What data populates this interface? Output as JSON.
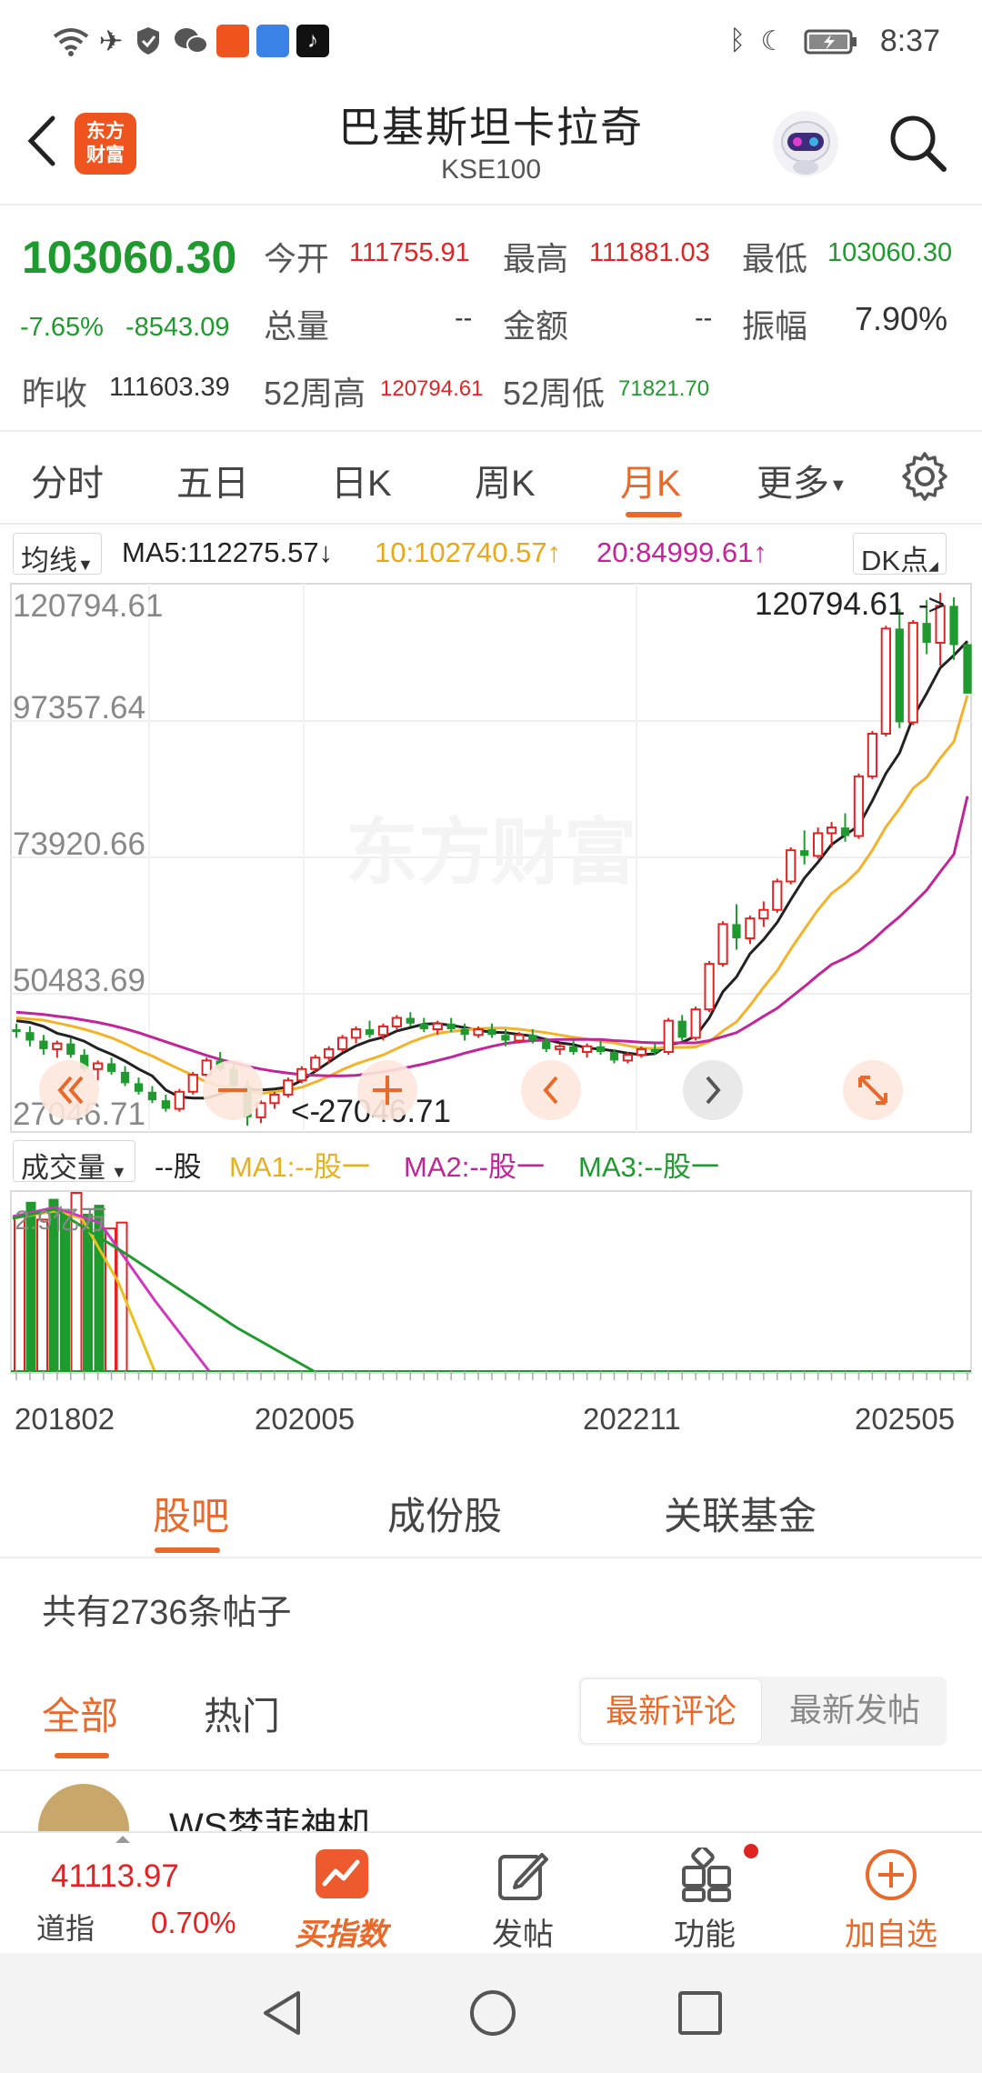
{
  "status_bar": {
    "time": "8:37",
    "icons": [
      "wifi-icon",
      "airplane-icon",
      "shield-icon",
      "wechat-icon",
      "app-icon-1",
      "weather-icon",
      "tiktok-icon",
      "bluetooth-icon",
      "moon-icon",
      "battery-icon"
    ]
  },
  "header": {
    "logo_line1": "东方",
    "logo_line2": "财富",
    "title": "巴基斯坦卡拉奇",
    "subtitle": "KSE100"
  },
  "quote": {
    "price": "103060.30",
    "change_pct": "-7.65%",
    "change_abs": "-8543.09",
    "open_label": "今开",
    "open": "111755.91",
    "high_label": "最高",
    "high": "111881.03",
    "low_label": "最低",
    "low": "103060.30",
    "volume_label": "总量",
    "volume": "--",
    "amount_label": "金额",
    "amount": "--",
    "amplitude_label": "振幅",
    "amplitude": "7.90%",
    "prev_close_label": "昨收",
    "prev_close": "111603.39",
    "wk52_high_label": "52周高",
    "wk52_high": "120794.61",
    "wk52_low_label": "52周低",
    "wk52_low": "71821.70"
  },
  "tabs": [
    "分时",
    "五日",
    "日K",
    "周K",
    "月K",
    "更多"
  ],
  "active_tab": "月K",
  "ma_legend": {
    "selector": "均线",
    "ma5": "MA5:112275.57",
    "ma5_arrow": "↓",
    "ma10": "10:102740.57",
    "ma10_arrow": "↑",
    "ma20": "20:84999.61",
    "ma20_arrow": "↑",
    "dk_button": "DK点"
  },
  "chart_data": {
    "type": "candlestick",
    "y_labels": [
      "120794.61",
      "97357.64",
      "73920.66",
      "50483.69",
      "27046.71"
    ],
    "ylim": [
      27046.71,
      120794.61
    ],
    "max_marker": "120794.61",
    "min_marker": "27046.71",
    "watermark": "东方财富",
    "colors": {
      "up": "#e02424",
      "down": "#1f9a2e",
      "ma5": "#222222",
      "ma10": "#f2b32a",
      "ma20": "#c2249a"
    },
    "candles": [
      [
        44000,
        45000,
        42500,
        43500
      ],
      [
        43500,
        44500,
        41000,
        42000
      ],
      [
        42000,
        43000,
        39500,
        40500
      ],
      [
        40500,
        42000,
        39000,
        41500
      ],
      [
        41500,
        42500,
        39000,
        39500
      ],
      [
        39500,
        40500,
        36500,
        37000
      ],
      [
        37000,
        38500,
        35000,
        38000
      ],
      [
        38000,
        39000,
        36000,
        36500
      ],
      [
        36500,
        37500,
        34000,
        34500
      ],
      [
        34500,
        35500,
        32500,
        33000
      ],
      [
        33000,
        34000,
        31000,
        31500
      ],
      [
        31500,
        32500,
        29500,
        30000
      ],
      [
        30000,
        33500,
        29500,
        33000
      ],
      [
        33000,
        36500,
        32500,
        36000
      ],
      [
        36000,
        39000,
        35500,
        38500
      ],
      [
        38500,
        40000,
        36500,
        37000
      ],
      [
        37000,
        38000,
        33000,
        34000
      ],
      [
        34000,
        35000,
        27046.71,
        28500
      ],
      [
        28500,
        31500,
        27500,
        31000
      ],
      [
        31000,
        33000,
        30000,
        32500
      ],
      [
        32500,
        35500,
        32000,
        35000
      ],
      [
        35000,
        37500,
        34500,
        37000
      ],
      [
        37000,
        39500,
        36500,
        39000
      ],
      [
        39000,
        41000,
        38000,
        40500
      ],
      [
        40500,
        43000,
        40000,
        42500
      ],
      [
        42500,
        44500,
        41500,
        44000
      ],
      [
        44000,
        45500,
        42500,
        43000
      ],
      [
        43000,
        45000,
        42000,
        44500
      ],
      [
        44500,
        46500,
        44000,
        46000
      ],
      [
        46000,
        47000,
        44500,
        45000
      ],
      [
        45000,
        46000,
        43500,
        44000
      ],
      [
        44000,
        45500,
        43000,
        45000
      ],
      [
        45000,
        46000,
        43500,
        44000
      ],
      [
        44000,
        45000,
        42000,
        43000
      ],
      [
        43000,
        44500,
        42500,
        44000
      ],
      [
        44000,
        45000,
        42500,
        43000
      ],
      [
        43000,
        44000,
        41000,
        42000
      ],
      [
        42000,
        43500,
        41500,
        43000
      ],
      [
        43000,
        44000,
        41500,
        42000
      ],
      [
        42000,
        42500,
        40000,
        40500
      ],
      [
        40500,
        41500,
        39500,
        41000
      ],
      [
        41000,
        42000,
        39500,
        40000
      ],
      [
        40000,
        41500,
        39000,
        41000
      ],
      [
        41000,
        42000,
        39500,
        40000
      ],
      [
        40000,
        40500,
        38000,
        38500
      ],
      [
        38500,
        40000,
        38000,
        39500
      ],
      [
        39500,
        41000,
        39000,
        40500
      ],
      [
        40500,
        41500,
        39500,
        40000
      ],
      [
        40000,
        46000,
        39500,
        45500
      ],
      [
        45500,
        46500,
        42000,
        42500
      ],
      [
        42500,
        48000,
        42000,
        47500
      ],
      [
        47500,
        56000,
        47000,
        55500
      ],
      [
        55500,
        63000,
        55000,
        62500
      ],
      [
        62500,
        66000,
        58000,
        60000
      ],
      [
        60000,
        64000,
        59000,
        63500
      ],
      [
        63500,
        66500,
        62000,
        65000
      ],
      [
        65000,
        70500,
        64500,
        70000
      ],
      [
        70000,
        76000,
        69500,
        75500
      ],
      [
        75500,
        79000,
        73000,
        74500
      ],
      [
        74500,
        79500,
        74000,
        78500
      ],
      [
        78500,
        80500,
        76000,
        79500
      ],
      [
        79500,
        82000,
        77000,
        78000
      ],
      [
        78000,
        89000,
        77500,
        88500
      ],
      [
        88500,
        96500,
        88000,
        96000
      ],
      [
        96000,
        115000,
        95500,
        114500
      ],
      [
        114500,
        118000,
        97000,
        98000
      ],
      [
        98000,
        116000,
        97500,
        115500
      ],
      [
        115500,
        119500,
        110000,
        112000
      ],
      [
        112000,
        120794.61,
        108000,
        118500
      ],
      [
        118500,
        120000,
        109000,
        111600
      ],
      [
        111755.91,
        111881.03,
        103060.3,
        103060.3
      ]
    ],
    "series": [
      {
        "name": "MA5",
        "values": [
          45500,
          45200,
          44500,
          43300,
          42700,
          41900,
          40600,
          39600,
          38400,
          37000,
          35800,
          33300,
          32100,
          31900,
          31900,
          32600,
          33400,
          33500,
          33300,
          33500,
          33800,
          35000,
          36600,
          38200,
          39800,
          41100,
          42000,
          42600,
          43700,
          44300,
          44900,
          45000,
          44700,
          44300,
          43800,
          43500,
          43400,
          43100,
          42800,
          42200,
          41600,
          41300,
          40700,
          40500,
          40200,
          39800,
          39500,
          39700,
          41300,
          41700,
          42800,
          46000,
          50600,
          53200,
          57300,
          59800,
          62800,
          66800,
          70600,
          73400,
          76500,
          78200,
          79800,
          84200,
          89000,
          92600,
          98900,
          103100,
          107600,
          109800,
          112276
        ]
      },
      {
        "name": "MA10",
        "values": [
          46000,
          45800,
          45600,
          45100,
          44600,
          44000,
          43300,
          42500,
          41500,
          40300,
          39300,
          38100,
          37000,
          35900,
          34700,
          34000,
          33600,
          33200,
          32700,
          33000,
          33300,
          33800,
          34700,
          35700,
          36900,
          37900,
          38700,
          39500,
          40600,
          41700,
          42600,
          43300,
          43600,
          43900,
          44100,
          44200,
          44200,
          44000,
          43700,
          43400,
          43000,
          42600,
          42300,
          41900,
          41600,
          41100,
          40700,
          40600,
          40800,
          40800,
          40900,
          41800,
          43700,
          45300,
          48200,
          51400,
          54300,
          58100,
          61600,
          65000,
          67900,
          69700,
          72000,
          75500,
          79600,
          82800,
          86400,
          88300,
          91700,
          94600,
          102741
        ]
      },
      {
        "name": "MA20",
        "values": [
          47000,
          46800,
          46600,
          46300,
          46000,
          45600,
          45200,
          44700,
          44100,
          43400,
          42600,
          41800,
          41000,
          40200,
          39400,
          38700,
          38100,
          37500,
          37000,
          36600,
          36300,
          36000,
          35900,
          35800,
          35800,
          35900,
          36200,
          36500,
          36900,
          37400,
          37900,
          38500,
          39100,
          39800,
          40400,
          41000,
          41500,
          41800,
          42000,
          42100,
          42200,
          42200,
          42200,
          42200,
          42000,
          41900,
          41700,
          41600,
          41600,
          41600,
          41600,
          42000,
          42700,
          43400,
          44800,
          46300,
          47700,
          49600,
          51500,
          53500,
          55400,
          56500,
          57800,
          59600,
          61800,
          63800,
          66100,
          68500,
          71700,
          74800,
          84999.61
        ]
      }
    ]
  },
  "volume_legend": {
    "selector": "成交量",
    "unit": "--股",
    "ma1": "MA1:--股一",
    "ma2": "MA2:--股一",
    "ma3": "MA3:--股一",
    "max_label": "2.9亿万",
    "x_labels": [
      "201802",
      "202005",
      "202211",
      "202505"
    ]
  },
  "volume_data": {
    "values": [
      260,
      285,
      255,
      290,
      270,
      300,
      265,
      280,
      240,
      250
    ],
    "colors": [
      "red",
      "green",
      "red",
      "green",
      "green",
      "red",
      "green",
      "green",
      "red",
      "red"
    ]
  },
  "section_tabs": [
    "股吧",
    "成份股",
    "关联基金"
  ],
  "active_section": "股吧",
  "post_count": "共有2736条帖子",
  "filter_tabs": [
    "全部",
    "热门"
  ],
  "sort_options": [
    "最新评论",
    "最新发帖"
  ],
  "post_peek_author": "WS梦菲神机",
  "bottom_nav": {
    "dji_value": "41113.97",
    "dji_label": "道指",
    "dji_change": "0.70%",
    "buy_index": "买指数",
    "post": "发帖",
    "features": "功能",
    "add_watch": "加自选"
  }
}
